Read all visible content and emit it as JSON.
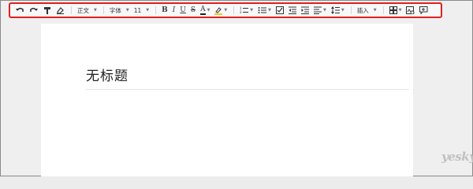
{
  "toolbar": {
    "style_label": "正文",
    "font_label": "字体",
    "size_label": "11",
    "insert_label": "插入",
    "bold_glyph": "B",
    "italic_glyph": "I",
    "underline_glyph": "U",
    "strike_glyph": "S",
    "font_color_glyph": "A",
    "font_color": "#222222",
    "highlight_color": "#f5c518"
  },
  "document": {
    "title_placeholder": "无标题"
  },
  "watermark": {
    "brand": "yesky"
  }
}
